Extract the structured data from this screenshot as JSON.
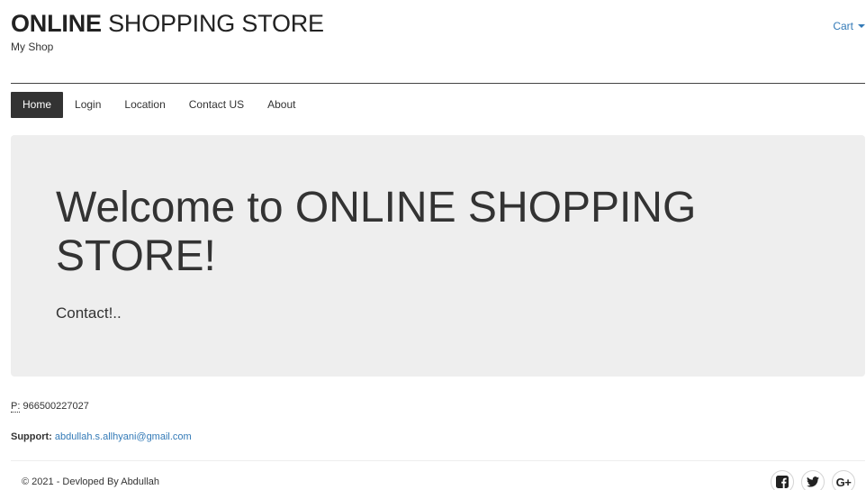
{
  "header": {
    "title_bold": "ONLINE",
    "title_rest": " SHOPPING STORE",
    "subtitle": "My Shop",
    "cart_label": "Cart"
  },
  "nav": {
    "items": [
      {
        "label": "Home",
        "active": true
      },
      {
        "label": "Login"
      },
      {
        "label": "Location"
      },
      {
        "label": "Contact US"
      },
      {
        "label": "About"
      }
    ]
  },
  "jumbotron": {
    "title": "Welcome to ONLINE SHOPPING STORE!",
    "text": "Contact!.."
  },
  "contact": {
    "phone_label": "P:",
    "phone_value": " 966500227027",
    "support_label": "Support:",
    "support_email": "abdullah.s.allhyani@gmail.com"
  },
  "footer": {
    "copyright": "© 2021 - Devloped By Abdullah",
    "social": [
      {
        "icon": "facebook-icon"
      },
      {
        "icon": "twitter-icon"
      },
      {
        "icon": "google-plus-icon",
        "glyph": "G+"
      }
    ]
  },
  "colors": {
    "link": "#337ab7",
    "nav_active_bg": "#333333",
    "jumbotron_bg": "#eeeeee"
  }
}
